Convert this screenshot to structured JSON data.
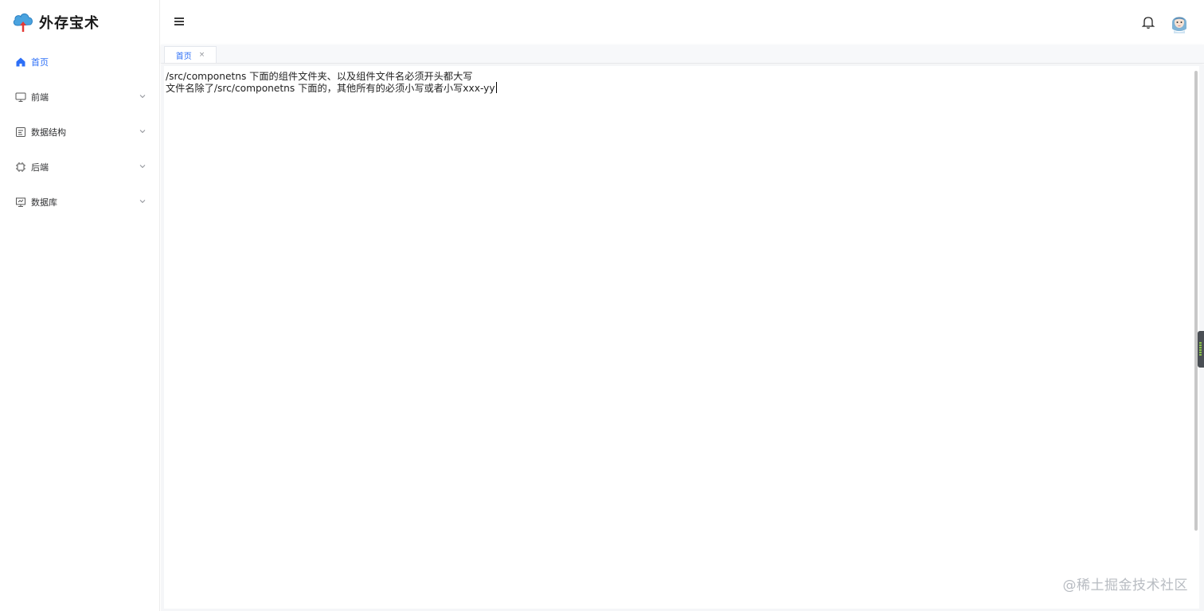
{
  "app": {
    "title": "外存宝术"
  },
  "sidebar": {
    "items": [
      {
        "label": "首页",
        "icon": "home-icon",
        "active": true
      },
      {
        "label": "前端",
        "icon": "monitor-icon",
        "expandable": true
      },
      {
        "label": "数据结构",
        "icon": "document-icon",
        "expandable": true
      },
      {
        "label": "后端",
        "icon": "chip-icon",
        "expandable": true
      },
      {
        "label": "数据库",
        "icon": "database-icon",
        "expandable": true
      }
    ]
  },
  "header": {
    "menu_toggle_icon": "hamburger-icon",
    "notification_icon": "bell-icon",
    "avatar_icon": "avatar-icon"
  },
  "tabs": [
    {
      "label": "首页",
      "close": "×"
    }
  ],
  "editor": {
    "lines": [
      "/src/componetns 下面的组件文件夹、以及组件文件名必须开头都大写",
      "文件名除了/src/componetns 下面的，其他所有的必须小写或者小写xxx-yy"
    ]
  },
  "watermark": "@稀土掘金技术社区",
  "colors": {
    "accent": "#2d6ff7",
    "text": "#303133",
    "logo_cloud": "#4aa3df",
    "logo_arrow": "#e53935"
  }
}
